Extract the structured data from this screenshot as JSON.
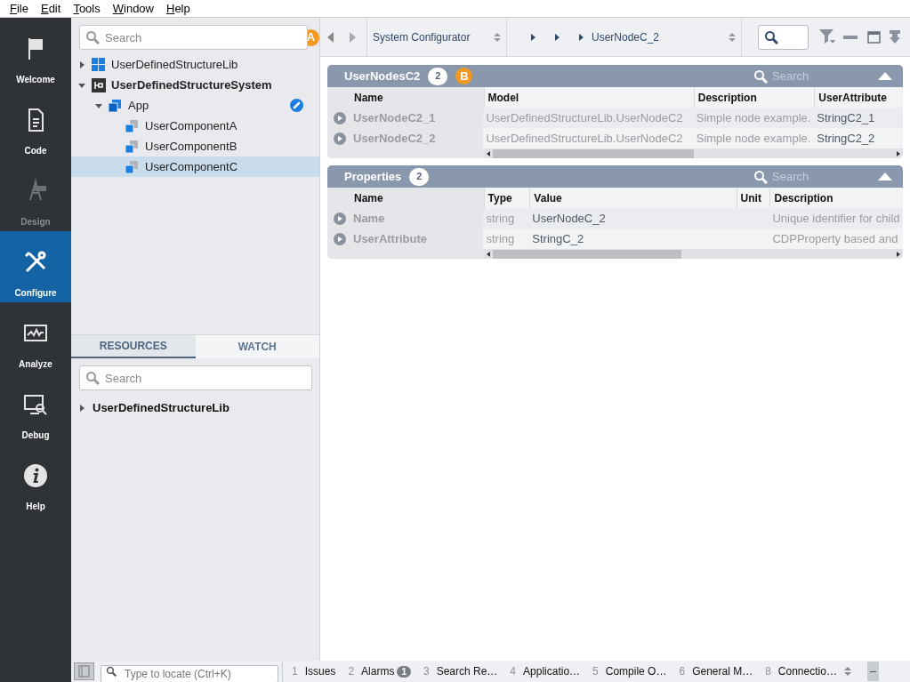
{
  "menu": [
    "File",
    "Edit",
    "Tools",
    "Window",
    "Help"
  ],
  "nav": [
    {
      "label": "Welcome",
      "kind": "flag",
      "selected": false,
      "disabled": false
    },
    {
      "label": "Code",
      "kind": "document",
      "selected": false,
      "disabled": false
    },
    {
      "label": "Design",
      "kind": "design",
      "selected": false,
      "disabled": true
    },
    {
      "label": "Configure",
      "kind": "tools",
      "selected": true,
      "disabled": false
    },
    {
      "label": "Analyze",
      "kind": "monitor",
      "selected": false,
      "disabled": false
    },
    {
      "label": "Debug",
      "kind": "debug",
      "selected": false,
      "disabled": false
    },
    {
      "label": "Help",
      "kind": "info",
      "selected": false,
      "disabled": false
    }
  ],
  "tree_search": {
    "placeholder": "Search",
    "marker": "A"
  },
  "tree": [
    {
      "label": "UserDefinedStructureLib",
      "kind": "lib",
      "expanded": false,
      "selected": false,
      "bold": false,
      "linked": false
    },
    {
      "label": "UserDefinedStructureSystem",
      "kind": "system",
      "expanded": true,
      "selected": false,
      "bold": true,
      "linked": false,
      "children": [
        {
          "label": "App",
          "kind": "app",
          "expanded": true,
          "selected": false,
          "bold": false,
          "linked": true,
          "children": [
            {
              "label": "UserComponentA",
              "kind": "component",
              "selected": false,
              "bold": false,
              "linked": false
            },
            {
              "label": "UserComponentB",
              "kind": "component",
              "selected": false,
              "bold": false,
              "linked": false
            },
            {
              "label": "UserComponentC",
              "kind": "component",
              "selected": true,
              "bold": false,
              "linked": false
            }
          ]
        }
      ]
    }
  ],
  "bottom_tabs": [
    {
      "label": "RESOURCES",
      "selected": true
    },
    {
      "label": "WATCH",
      "selected": false
    }
  ],
  "resources_search": {
    "placeholder": "Search"
  },
  "resources": [
    {
      "label": "UserDefinedStructureLib",
      "expanded": false
    }
  ],
  "toolbar": {
    "combo": "System Configurator",
    "breadcrumb": "UserNodeC_2"
  },
  "panels": [
    {
      "title": "UserNodesC2",
      "count": "2",
      "marker": "B",
      "search_placeholder": "Search",
      "columns": [
        "Name",
        "Model",
        "Description",
        "UserAttribute"
      ],
      "rows": [
        [
          "UserNodeC2_1",
          "UserDefinedStructureLib.UserNodeC2",
          "Simple node example.",
          "StringC2_1"
        ],
        [
          "UserNodeC2_2",
          "UserDefinedStructureLib.UserNodeC2",
          "Simple node example.",
          "StringC2_2"
        ]
      ]
    },
    {
      "title": "Properties",
      "count": "2",
      "search_placeholder": "Search",
      "columns": [
        "Name",
        "Type",
        "Value",
        "Unit",
        "Description"
      ],
      "rows": [
        [
          "Name",
          "string",
          "UserNodeC_2",
          "",
          "Unique identifier for child"
        ],
        [
          "UserAttribute",
          "string",
          "StringC_2",
          "",
          "CDPProperty based and"
        ]
      ]
    }
  ],
  "status_bar": {
    "locate_placeholder": "Type to locate (Ctrl+K)",
    "tabs": [
      {
        "number": "1",
        "label": "Issues"
      },
      {
        "number": "2",
        "label": "Alarms",
        "badge": "1"
      },
      {
        "number": "3",
        "label": "Search Re…"
      },
      {
        "number": "4",
        "label": "Applicatio…"
      },
      {
        "number": "5",
        "label": "Compile O…"
      },
      {
        "number": "6",
        "label": "General M…"
      },
      {
        "number": "8",
        "label": "Connectio…"
      }
    ]
  }
}
